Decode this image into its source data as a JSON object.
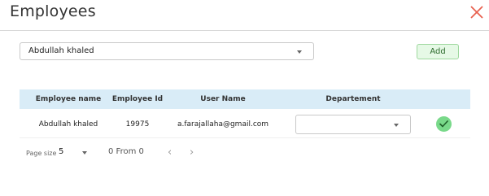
{
  "dialog": {
    "title": "Employees",
    "close_icon": "close-icon",
    "close_color": "#e8614f"
  },
  "employee_select": {
    "value": "Abdullah khaled"
  },
  "add_button": {
    "label": "Add"
  },
  "table": {
    "headers": [
      "Employee name",
      "Employee Id",
      "User Name",
      "Departement"
    ],
    "header_bg": "#d9ecf7",
    "rows": [
      {
        "employee_name": "Abdullah khaled",
        "employee_id": "19975",
        "user_name": "a.farajallaha@gmail.com",
        "department": "",
        "action_icon": "check-icon"
      }
    ]
  },
  "pager": {
    "page_size_label": "Page size",
    "page_size": "5",
    "info": "0 From 0",
    "prev_icon": "chevron-left-icon",
    "next_icon": "chevron-right-icon"
  },
  "colors": {
    "accent_green": "#79d98a",
    "add_button_bg": "#e6f9e6"
  }
}
